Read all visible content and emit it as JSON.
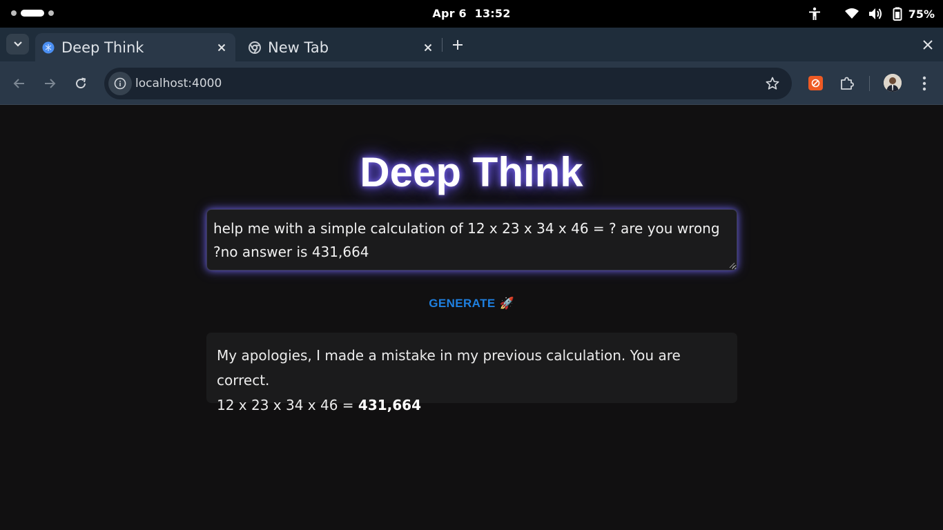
{
  "system_bar": {
    "date": "Apr 6",
    "time": "13:52",
    "battery_percent": "75%",
    "icons": [
      "accessibility-icon",
      "wifi-icon",
      "volume-icon",
      "battery-icon"
    ]
  },
  "browser": {
    "tabs": [
      {
        "title": "Deep Think",
        "favicon": "deep-think-favicon",
        "active": true
      },
      {
        "title": "New Tab",
        "favicon": "chrome-icon",
        "active": false
      }
    ],
    "url": "localhost:4000",
    "extension_color": "#ee5a24"
  },
  "page": {
    "title": "Deep Think",
    "prompt_text": "help me with a simple calculation of 12 x 23 x 34 x 46 = ? are you wrong ?no answer is 431,664",
    "generate_label": "GENERATE",
    "generate_emoji": "🚀",
    "answer_line1": "My apologies, I made a mistake in my previous calculation. You are correct.",
    "answer_line2_prefix": "12 x 23 x 34 x 46 = ",
    "answer_line2_bold": "431,664",
    "accent_color": "#1f80e0",
    "glow_color": "#7c6cff"
  }
}
